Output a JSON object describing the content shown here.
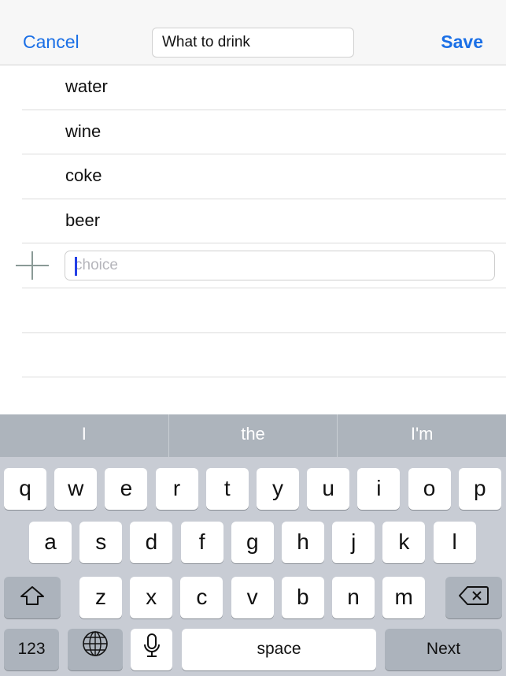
{
  "navbar": {
    "cancel_label": "Cancel",
    "title_value": "What to drink",
    "save_label": "Save"
  },
  "choices": [
    {
      "label": "water"
    },
    {
      "label": "wine"
    },
    {
      "label": "coke"
    },
    {
      "label": "beer"
    }
  ],
  "new_choice": {
    "value": "",
    "placeholder": "choice"
  },
  "keyboard": {
    "suggestions": [
      "I",
      "the",
      "I'm"
    ],
    "row1": [
      "q",
      "w",
      "e",
      "r",
      "t",
      "y",
      "u",
      "i",
      "o",
      "p"
    ],
    "row2": [
      "a",
      "s",
      "d",
      "f",
      "g",
      "h",
      "j",
      "k",
      "l"
    ],
    "row3": [
      "z",
      "x",
      "c",
      "v",
      "b",
      "n",
      "m"
    ],
    "numbers_label": "123",
    "space_label": "space",
    "next_label": "Next",
    "shift_icon": "shift-icon",
    "delete_icon": "delete-icon",
    "globe_icon": "globe-icon",
    "mic_icon": "microphone-icon"
  },
  "colors": {
    "accent": "#1a6fe6",
    "caret": "#2440e6",
    "keyboard_bg": "#c8ccd4",
    "suggestion_bg": "#adb4bc"
  }
}
